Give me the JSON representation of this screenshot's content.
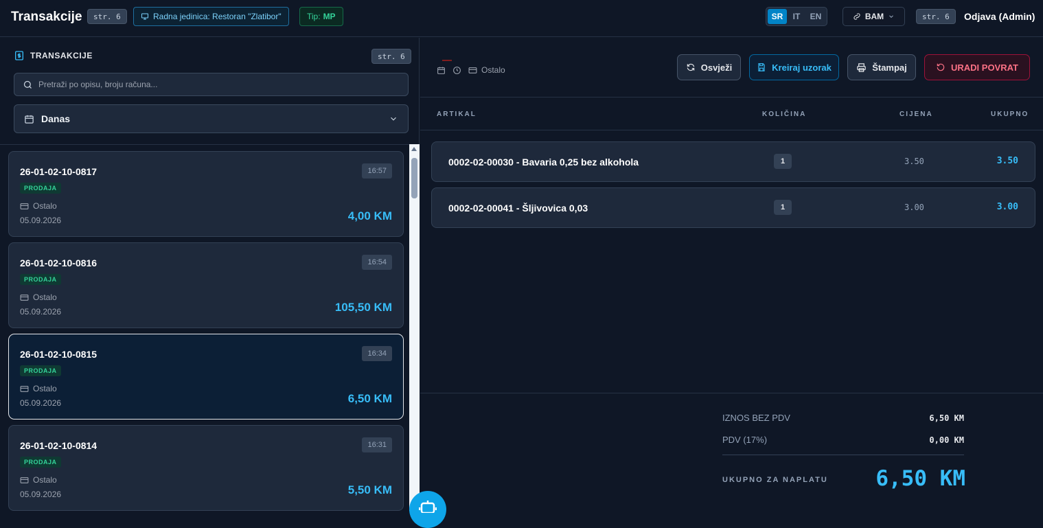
{
  "header": {
    "title": "Transakcije",
    "page_tag": "str. 6",
    "unit_label": "Radna jedinica: Restoran \"Zlatibor\"",
    "type_label": "Tip:",
    "type_value": "MP",
    "languages": [
      "SR",
      "IT",
      "EN"
    ],
    "active_language": "SR",
    "currency": "BAM",
    "page_tag_2": "str. 6",
    "logout": "Odjava (Admin)"
  },
  "sidebar": {
    "heading": "TRANSAKCIJE",
    "page_tag": "str. 6",
    "search_placeholder": "Pretraži po opisu, broju računa...",
    "date_filter": "Danas",
    "transactions": [
      {
        "number": "26-01-02-10-0817",
        "time": "16:57",
        "type": "PRODAJA",
        "payment": "Ostalo",
        "date": "05.09.2026",
        "amount": "4,00 KM",
        "selected": false
      },
      {
        "number": "26-01-02-10-0816",
        "time": "16:54",
        "type": "PRODAJA",
        "payment": "Ostalo",
        "date": "05.09.2026",
        "amount": "105,50 KM",
        "selected": false
      },
      {
        "number": "26-01-02-10-0815",
        "time": "16:34",
        "type": "PRODAJA",
        "payment": "Ostalo",
        "date": "05.09.2026",
        "amount": "6,50 KM",
        "selected": true
      },
      {
        "number": "26-01-02-10-0814",
        "time": "16:31",
        "type": "PRODAJA",
        "payment": "Ostalo",
        "date": "05.09.2026",
        "amount": "5,50 KM",
        "selected": false
      }
    ]
  },
  "detail": {
    "payment_method": "Ostalo",
    "buttons": {
      "refresh": "Osvježi",
      "template": "Kreiraj uzorak",
      "print": "Štampaj",
      "refund": "URADI POVRAT"
    },
    "columns": {
      "item": "ARTIKAL",
      "qty": "KOLIČINA",
      "price": "CIJENA",
      "total": "UKUPNO"
    },
    "items": [
      {
        "name": "0002-02-00030 - Bavaria 0,25 bez alkohola",
        "qty": "1",
        "price": "3.50",
        "total": "3.50"
      },
      {
        "name": "0002-02-00041 - Šljivovica 0,03",
        "qty": "1",
        "price": "3.00",
        "total": "3.00"
      }
    ],
    "summary": {
      "net_label": "IZNOS BEZ PDV",
      "net_value": "6,50 KM",
      "vat_label": "PDV (17%)",
      "vat_value": "0,00 KM",
      "total_label": "UKUPNO ZA NAPLATU",
      "total_value": "6,50 KM"
    }
  },
  "colors": {
    "accent": "#38bdf8",
    "success": "#34d399",
    "danger": "#fb7185",
    "background": "#0f1726"
  }
}
